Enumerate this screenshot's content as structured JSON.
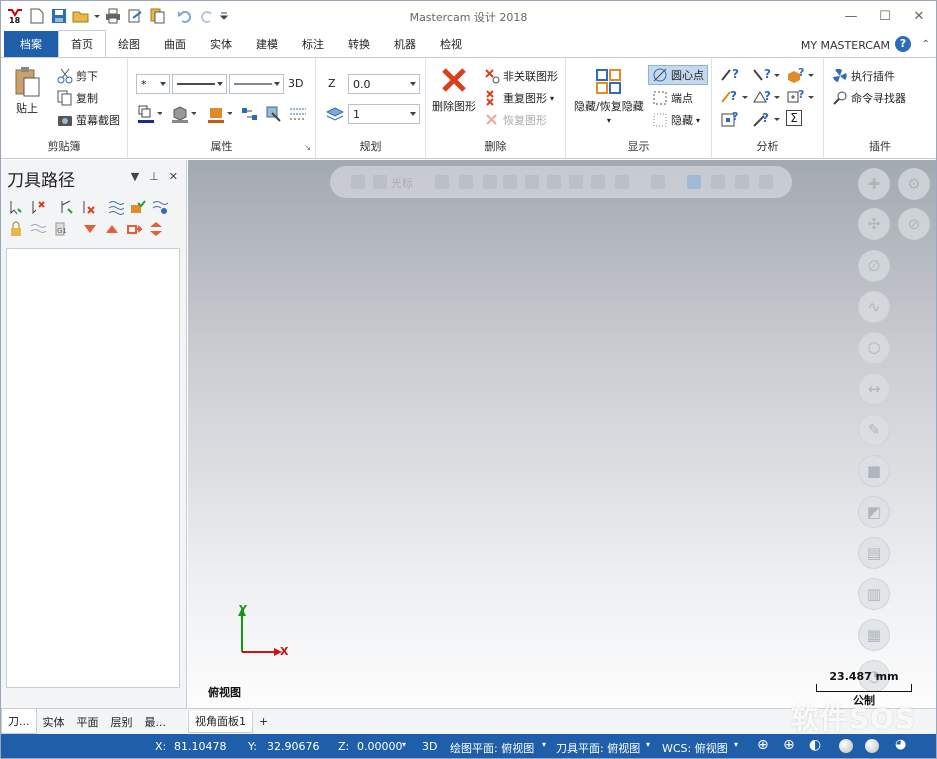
{
  "window": {
    "title": "Mastercam 设计 2018",
    "logo_text": "18"
  },
  "tabs": {
    "file": "档案",
    "home": "首页",
    "items": [
      "绘图",
      "曲面",
      "实体",
      "建模",
      "标注",
      "转换",
      "机器",
      "检视"
    ],
    "right_label": "MY MASTERCAM",
    "help": "?"
  },
  "clipboard": {
    "paste": "贴上",
    "cut": "剪下",
    "copy": "复制",
    "screenshot": "萤幕截图",
    "label": "剪贴簿"
  },
  "attributes": {
    "point_style": "*",
    "mode_3d": "3D",
    "label": "属性"
  },
  "planning": {
    "z_label": "Z",
    "z_value": "0.0",
    "level_value": "1",
    "label": "规划"
  },
  "delete": {
    "delete_entity": "删除图形",
    "unassoc": "非关联图形",
    "duplicate": "重复图形",
    "restore": "恢复图形",
    "label": "删除"
  },
  "display": {
    "hide_unhide": "隐藏/恢复隐藏",
    "center_point": "圆心点",
    "endpoints": "端点",
    "hide": "隐藏",
    "label": "显示"
  },
  "analyze": {
    "label": "分析",
    "sum_symbol": "Σ"
  },
  "addins": {
    "run_addin": "执行插件",
    "cmd_finder": "命令寻找器",
    "label": "插件"
  },
  "panel": {
    "title": "刀具路径",
    "bottom_tabs": [
      "刀...",
      "实体",
      "平面",
      "层别",
      "最..."
    ]
  },
  "viewport": {
    "toolbar_cursor": "光标",
    "view_name": "俯视图",
    "scale_value": "23.487 mm",
    "scale_unit": "公制",
    "axis_y": "Y",
    "axis_x": "X"
  },
  "viewsheet": {
    "tab": "视角面板1",
    "add": "+"
  },
  "watermark": "软件SOS",
  "status": {
    "x_label": "X:",
    "x_value": "81.10478",
    "y_label": "Y:",
    "y_value": "32.90676",
    "z_label": "Z:",
    "z_value": "0.00000",
    "mode": "3D",
    "cplane": "绘图平面: 俯视图",
    "tplane": "刀具平面: 俯视图",
    "wcs": "WCS: 俯视图"
  },
  "colors": {
    "accent": "#1f5fa9",
    "axis_x": "#cc1111",
    "axis_y": "#119911"
  }
}
